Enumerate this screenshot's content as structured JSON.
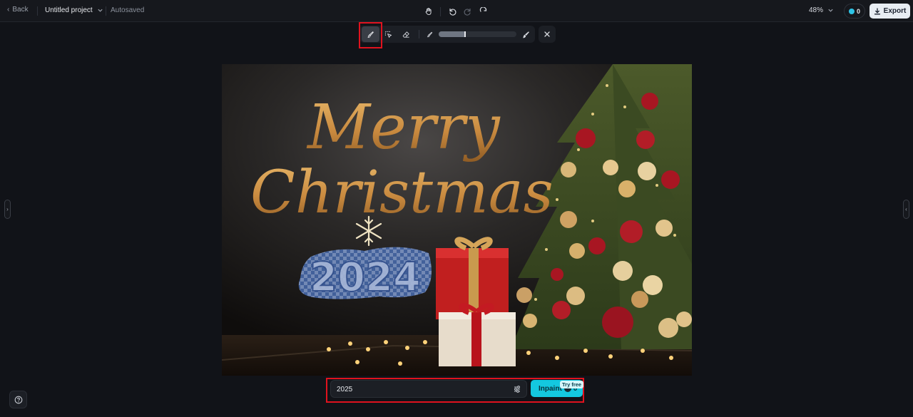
{
  "topbar": {
    "back_label": "Back",
    "project_name": "Untitled project",
    "save_status": "Autosaved",
    "zoom_level": "48%",
    "credits": "0",
    "export_label": "Export"
  },
  "brush_toolbar": {
    "tools": [
      "brush-icon",
      "smart-select-icon",
      "eraser-icon"
    ],
    "active_tool": "brush",
    "brush_size_fraction": 0.34
  },
  "canvas": {
    "greeting_line1": "Merry",
    "greeting_line2": "Christmas",
    "selected_text": "2024"
  },
  "prompt": {
    "value": "2025",
    "generate_label": "Inpaint",
    "generate_cost": "0",
    "badge": "Try free"
  },
  "colors": {
    "accent": "#14c8df",
    "highlight": "#e0121e",
    "gold": "#c9924a"
  }
}
